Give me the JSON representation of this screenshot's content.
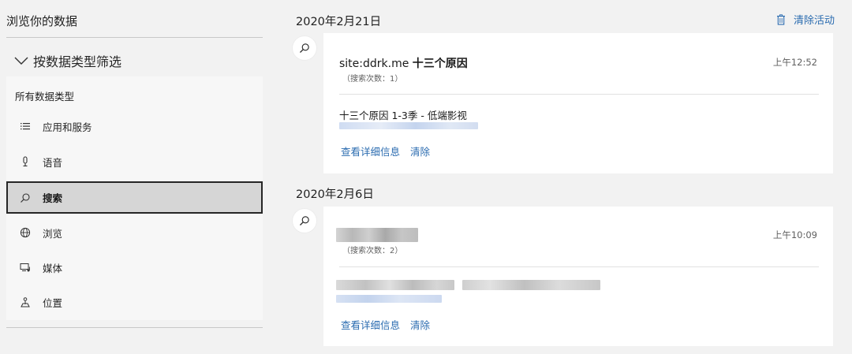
{
  "sidebar": {
    "title": "浏览你的数据",
    "filter_label": "按数据类型筛选",
    "all_types": "所有数据类型",
    "items": [
      {
        "label": "应用和服务",
        "icon": "list-icon"
      },
      {
        "label": "语音",
        "icon": "microphone-icon"
      },
      {
        "label": "搜索",
        "icon": "search-icon",
        "selected": true
      },
      {
        "label": "浏览",
        "icon": "globe-icon"
      },
      {
        "label": "媒体",
        "icon": "media-icon"
      },
      {
        "label": "位置",
        "icon": "location-icon"
      }
    ]
  },
  "header": {
    "clear_activity": "清除活动"
  },
  "groups": [
    {
      "date": "2020年2月21日",
      "entry": {
        "query_prefix": "site:ddrk.me ",
        "query_bold": "十三个原因",
        "count": "（搜索次数：1）",
        "time": "上午12:52",
        "result_title": "十三个原因 1-3季 - 低端影视",
        "details_link": "查看详细信息",
        "clear_link": "清除"
      }
    },
    {
      "date": "2020年2月6日",
      "entry": {
        "count": "（搜索次数：2）",
        "time": "上午10:09",
        "details_link": "查看详细信息",
        "clear_link": "清除"
      }
    }
  ],
  "colors": {
    "accent": "#2b6cb0",
    "background": "#f2f2f2",
    "card": "#ffffff",
    "selected": "#d6d6d6"
  }
}
